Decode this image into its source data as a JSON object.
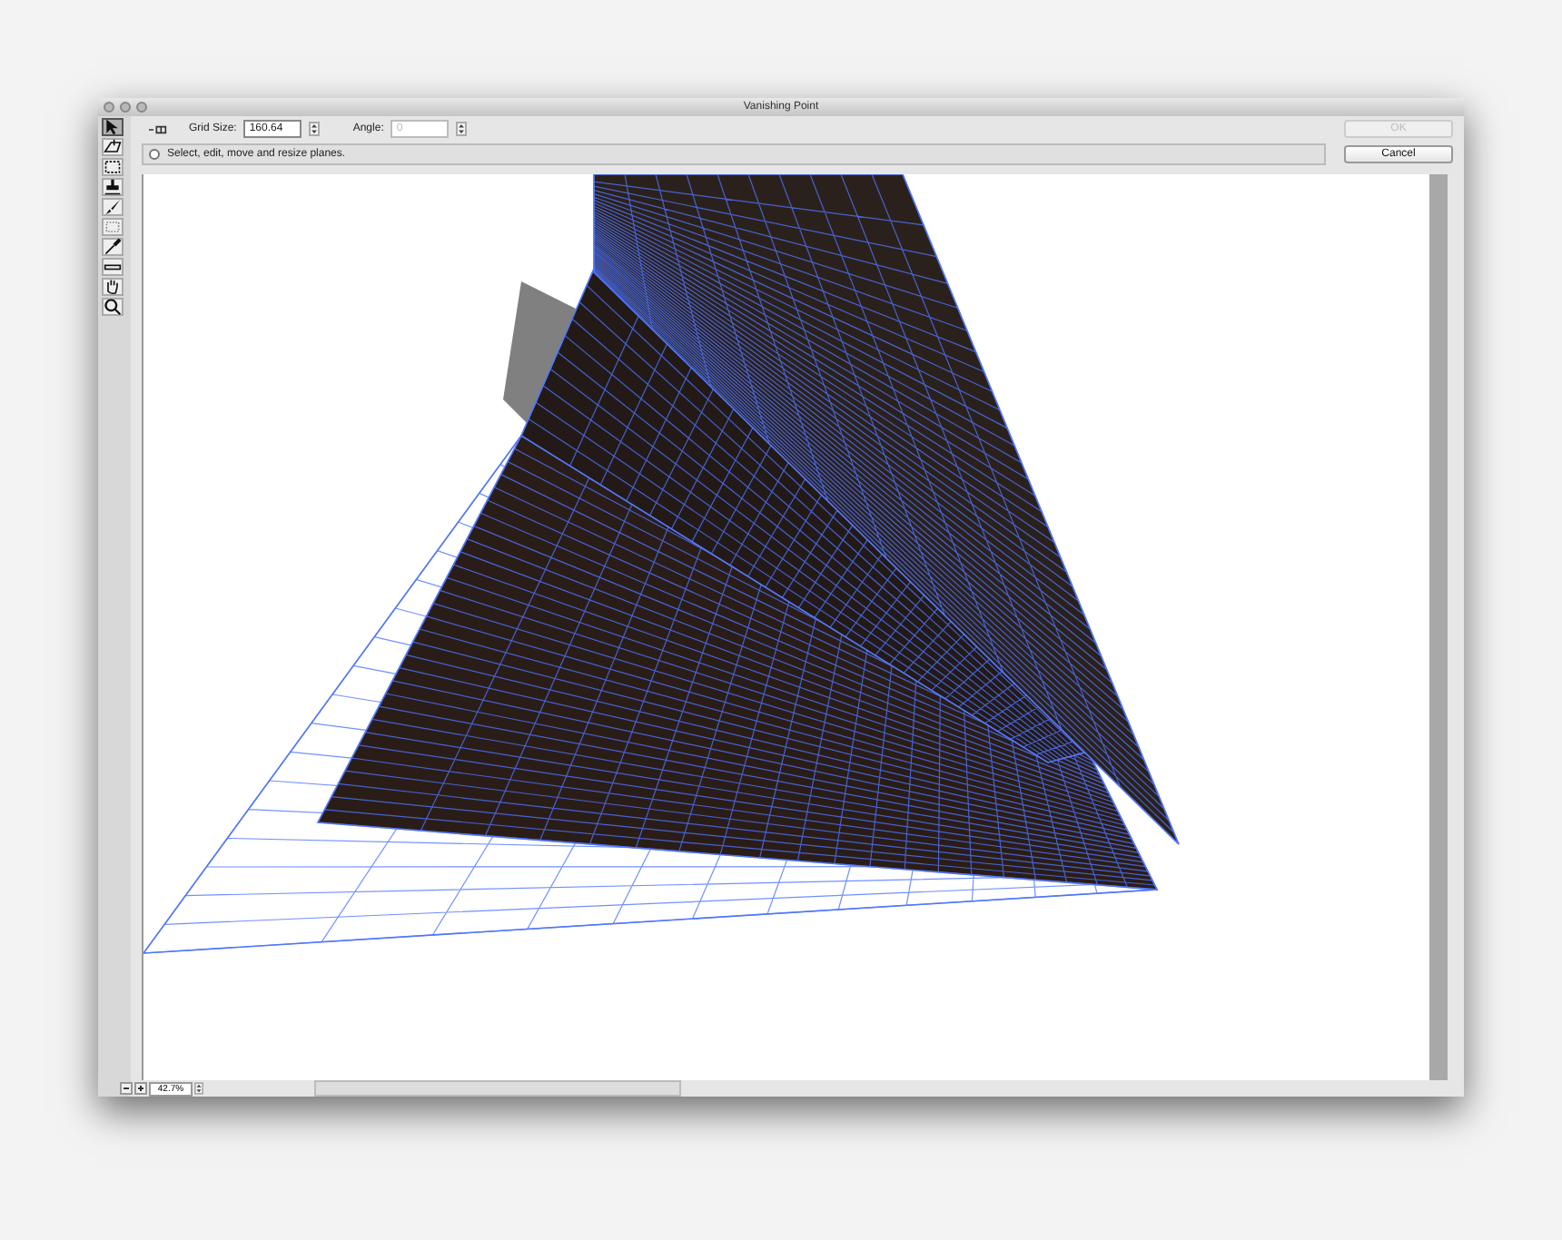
{
  "window": {
    "title": "Vanishing Point"
  },
  "tools": [
    {
      "kind": "arrow",
      "selected": true
    },
    {
      "kind": "plane",
      "selected": false
    },
    {
      "kind": "marquee",
      "selected": false
    },
    {
      "kind": "stamp",
      "selected": false
    },
    {
      "kind": "brush",
      "selected": false
    },
    {
      "kind": "transform",
      "selected": false
    },
    {
      "kind": "eyedropper",
      "selected": false
    },
    {
      "kind": "ruler",
      "selected": false
    },
    {
      "kind": "hand",
      "selected": false
    },
    {
      "kind": "zoom",
      "selected": false
    }
  ],
  "options": {
    "grid_size": {
      "label": "Grid Size:",
      "value": "160.64",
      "disabled": false
    },
    "angle": {
      "label": "Angle:",
      "value": "0",
      "disabled": true
    }
  },
  "message": "Select, edit, move and resize planes.",
  "buttons": [
    {
      "label": "OK",
      "disabled": true
    },
    {
      "label": "Cancel",
      "disabled": false
    }
  ],
  "status_bar": {
    "zoom": "42.7%"
  }
}
